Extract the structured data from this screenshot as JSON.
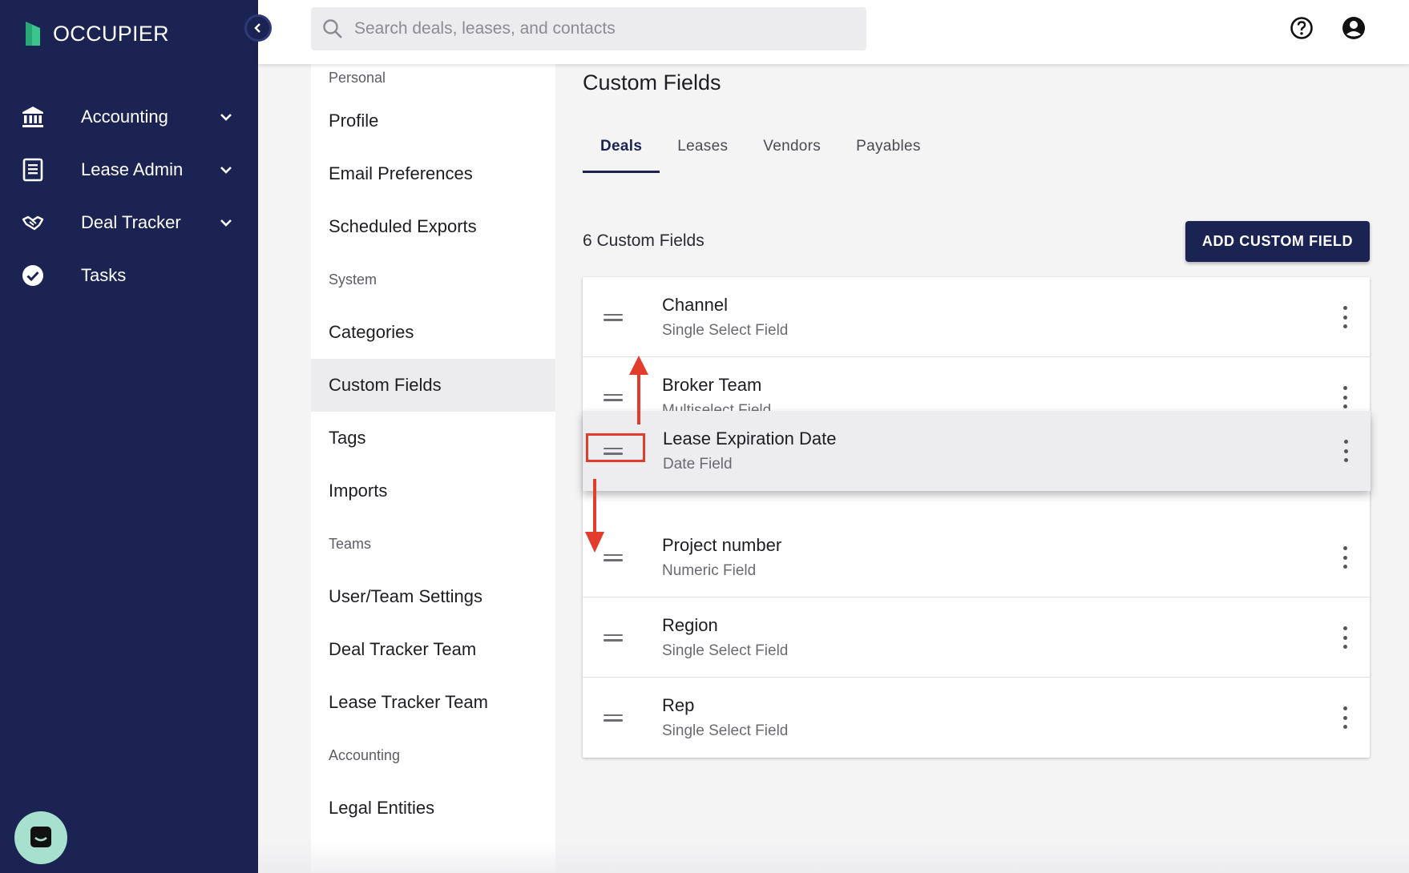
{
  "app": {
    "brand_name": "OCCUPIER",
    "brand_color": "#1a2352",
    "accent_green": "#3cc48d"
  },
  "sidebar": {
    "items": [
      {
        "label": "Accounting",
        "icon": "bank-icon",
        "has_chevron": true
      },
      {
        "label": "Lease Admin",
        "icon": "document-icon",
        "has_chevron": true
      },
      {
        "label": "Deal Tracker",
        "icon": "handshake-icon",
        "has_chevron": true
      },
      {
        "label": "Tasks",
        "icon": "check-circle-icon",
        "has_chevron": false
      }
    ],
    "chat_icon": "chat-bubble-icon"
  },
  "topbar": {
    "search_placeholder": "Search deals, leases, and contacts",
    "help_icon": "help-circle-icon",
    "account_icon": "account-circle-icon"
  },
  "settings_menu": {
    "groups": [
      {
        "header": "Personal",
        "items": [
          "Profile",
          "Email Preferences",
          "Scheduled Exports"
        ]
      },
      {
        "header": "System",
        "items": [
          "Categories",
          "Custom Fields",
          "Tags",
          "Imports"
        ]
      },
      {
        "header": "Teams",
        "items": [
          "User/Team Settings",
          "Deal Tracker Team",
          "Lease Tracker Team"
        ]
      },
      {
        "header": "Accounting",
        "items": [
          "Legal Entities"
        ]
      }
    ],
    "active_item": "Custom Fields"
  },
  "main": {
    "title": "Custom Fields",
    "tabs": [
      "Deals",
      "Leases",
      "Vendors",
      "Payables"
    ],
    "active_tab": "Deals",
    "count_label": "6 Custom Fields",
    "add_button_label": "ADD CUSTOM FIELD",
    "fields": [
      {
        "name": "Channel",
        "type": "Single Select Field"
      },
      {
        "name": "Broker Team",
        "type": "Multiselect Field"
      },
      {
        "name": "Project number",
        "type": "Numeric Field"
      },
      {
        "name": "Region",
        "type": "Single Select Field"
      },
      {
        "name": "Rep",
        "type": "Single Select Field"
      }
    ],
    "dragging_field": {
      "name": "Lease Expiration Date",
      "type": "Date Field"
    }
  },
  "annotation": {
    "color": "#e13c2c"
  }
}
